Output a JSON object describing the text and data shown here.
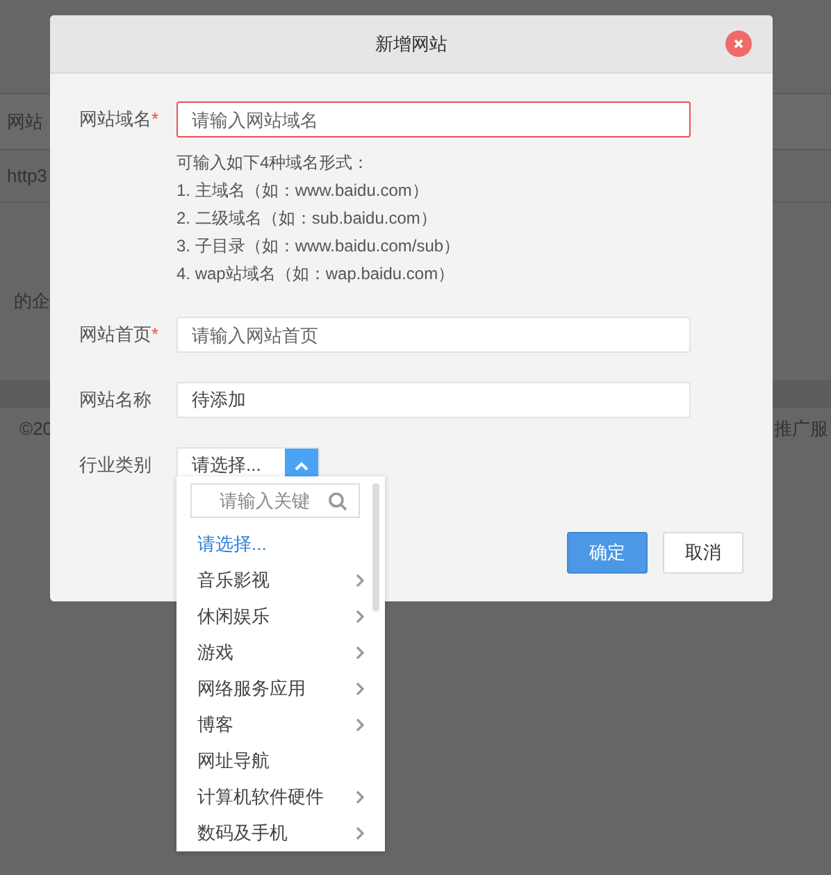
{
  "background": {
    "table_header": "网站",
    "table_cell": "http3",
    "description": "的企",
    "footer_left": "©20",
    "footer_right": "推广服"
  },
  "dialog": {
    "title": "新增网站",
    "fields": [
      {
        "label": "网站域名",
        "required_mark": "*",
        "error": true,
        "placeholder": "请输入网站域名"
      },
      {
        "label": "网站首页",
        "required_mark": "*",
        "error": false,
        "placeholder": "请输入网站首页"
      },
      {
        "label": "网站名称",
        "error": false,
        "value": "待添加"
      }
    ],
    "hint": {
      "title": "可输入如下4种域名形式：",
      "lines": [
        "1. 主域名（如：www.baidu.com）",
        "2. 二级域名（如：sub.baidu.com）",
        "3. 子目录（如：www.baidu.com/sub）",
        "4. wap站域名（如：wap.baidu.com）"
      ]
    },
    "category": {
      "label": "行业类别",
      "value": "请选择...",
      "expanded": true,
      "search_placeholder": "请输入关键",
      "options": [
        {
          "label": "请选择...",
          "selected": true,
          "has_children": false
        },
        {
          "label": "音乐影视",
          "selected": false,
          "has_children": true
        },
        {
          "label": "休闲娱乐",
          "selected": false,
          "has_children": true
        },
        {
          "label": "游戏",
          "selected": false,
          "has_children": true
        },
        {
          "label": "网络服务应用",
          "selected": false,
          "has_children": true
        },
        {
          "label": "博客",
          "selected": false,
          "has_children": true
        },
        {
          "label": "网址导航",
          "selected": false,
          "has_children": false
        },
        {
          "label": "计算机软件硬件",
          "selected": false,
          "has_children": true
        },
        {
          "label": "数码及手机",
          "selected": false,
          "has_children": true
        }
      ]
    },
    "buttons": [
      {
        "label": "确定",
        "kind": "primary"
      },
      {
        "label": "取消",
        "kind": "secondary"
      }
    ]
  }
}
